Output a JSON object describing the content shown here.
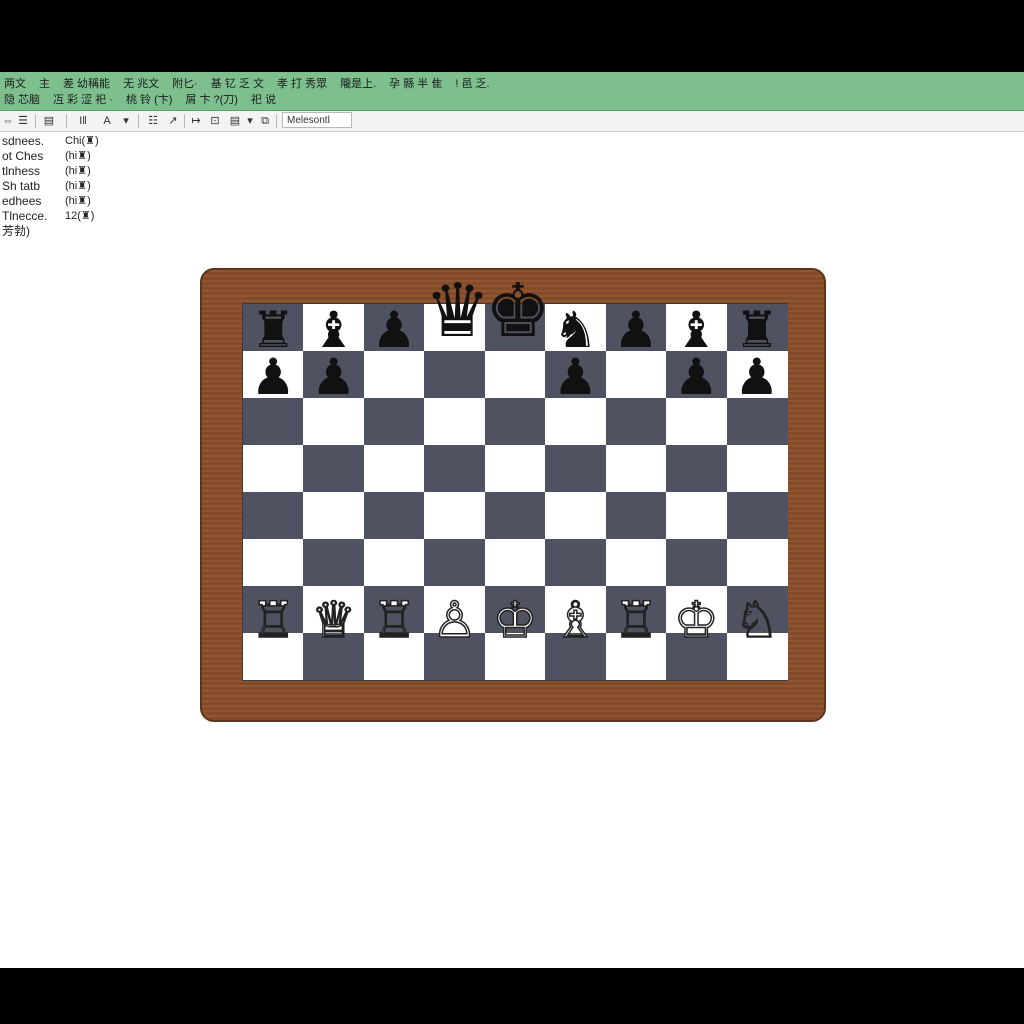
{
  "menubar": {
    "row1": [
      "两文",
      "主",
      "差 幼稱能",
      "无 兆文",
      "附匕·",
      "基 钇 乏 文",
      "孝 打 秀眾",
      "隴是上.",
      "孕 縣 半 隹",
      "! 邑 乏."
    ],
    "row2": [
      "隐 芯脑",
      "冱 彩 涩 祀 ·",
      "桃 铃 (卞)",
      "屑 卞 ?(刀)",
      "祀 说"
    ]
  },
  "toolbar": {
    "buttons": [
      "⇔",
      "☰",
      "▤",
      "I‖",
      "A",
      "▾",
      "☷",
      "↗",
      "↦",
      "⊡",
      "▤",
      "▾",
      "⧉"
    ],
    "field_value": "Melesontl"
  },
  "side_list": [
    {
      "name": "sdnees.",
      "value": "Chi(♜)"
    },
    {
      "name": "ot Ches",
      "value": "(hi♜)"
    },
    {
      "name": "tlnhess",
      "value": "(hi♜)"
    },
    {
      "name": "Sh tatb",
      "value": "(hi♜)"
    },
    {
      "name": "edhees",
      "value": "(hi♜)"
    },
    {
      "name": "Tlnecce.",
      "value": "12(♜)"
    },
    {
      "name": "芳勃)",
      "value": ""
    }
  ],
  "board": {
    "files": 9,
    "ranks": 8,
    "dark_color": "#4f5260",
    "light_color": "#ffffff",
    "pieces": [
      {
        "glyph": "♜",
        "color": "black",
        "file": 0,
        "rank": 0,
        "name": "black-rook-icon"
      },
      {
        "glyph": "♝",
        "color": "black",
        "file": 1,
        "rank": 0,
        "name": "black-bishop-icon"
      },
      {
        "glyph": "♟",
        "color": "black",
        "file": 2,
        "rank": 0,
        "name": "black-pawn-icon"
      },
      {
        "glyph": "♛",
        "color": "black",
        "file": 3,
        "rank": 0,
        "name": "black-queen-icon"
      },
      {
        "glyph": "♚",
        "color": "black",
        "file": 4,
        "rank": 0,
        "name": "black-king-icon"
      },
      {
        "glyph": "♞",
        "color": "black",
        "file": 5,
        "rank": 0,
        "name": "black-knight-icon"
      },
      {
        "glyph": "♟",
        "color": "black",
        "file": 6,
        "rank": 0,
        "name": "black-pawn-icon"
      },
      {
        "glyph": "♝",
        "color": "black",
        "file": 7,
        "rank": 0,
        "name": "black-bishop-icon"
      },
      {
        "glyph": "♜",
        "color": "black",
        "file": 8,
        "rank": 0,
        "name": "black-rook-icon"
      },
      {
        "glyph": "♟",
        "color": "black",
        "file": 0,
        "rank": 1,
        "name": "black-pawn-icon"
      },
      {
        "glyph": "♟",
        "color": "black",
        "file": 1,
        "rank": 1,
        "name": "black-pawn-icon"
      },
      {
        "glyph": "♟",
        "color": "black",
        "file": 5,
        "rank": 1,
        "name": "black-pawn-icon"
      },
      {
        "glyph": "♟",
        "color": "black",
        "file": 7,
        "rank": 1,
        "name": "black-pawn-icon"
      },
      {
        "glyph": "♟",
        "color": "black",
        "file": 8,
        "rank": 1,
        "name": "black-pawn-icon"
      },
      {
        "glyph": "♖",
        "color": "white",
        "file": 0,
        "rank": 7,
        "name": "white-rook-icon"
      },
      {
        "glyph": "♕",
        "color": "white",
        "file": 1,
        "rank": 7,
        "name": "white-queen-icon"
      },
      {
        "glyph": "♖",
        "color": "white",
        "file": 2,
        "rank": 7,
        "name": "white-rook-icon"
      },
      {
        "glyph": "♙",
        "color": "white",
        "file": 3,
        "rank": 7,
        "name": "white-pawn-icon"
      },
      {
        "glyph": "♔",
        "color": "white",
        "file": 4,
        "rank": 7,
        "name": "white-king-icon"
      },
      {
        "glyph": "♗",
        "color": "white",
        "file": 5,
        "rank": 7,
        "name": "white-bishop-icon"
      },
      {
        "glyph": "♖",
        "color": "white",
        "file": 6,
        "rank": 7,
        "name": "white-rook-icon"
      },
      {
        "glyph": "♔",
        "color": "white",
        "file": 7,
        "rank": 7,
        "name": "white-king-icon"
      },
      {
        "glyph": "♘",
        "color": "white",
        "file": 8,
        "rank": 7,
        "name": "white-knight-icon"
      }
    ]
  }
}
